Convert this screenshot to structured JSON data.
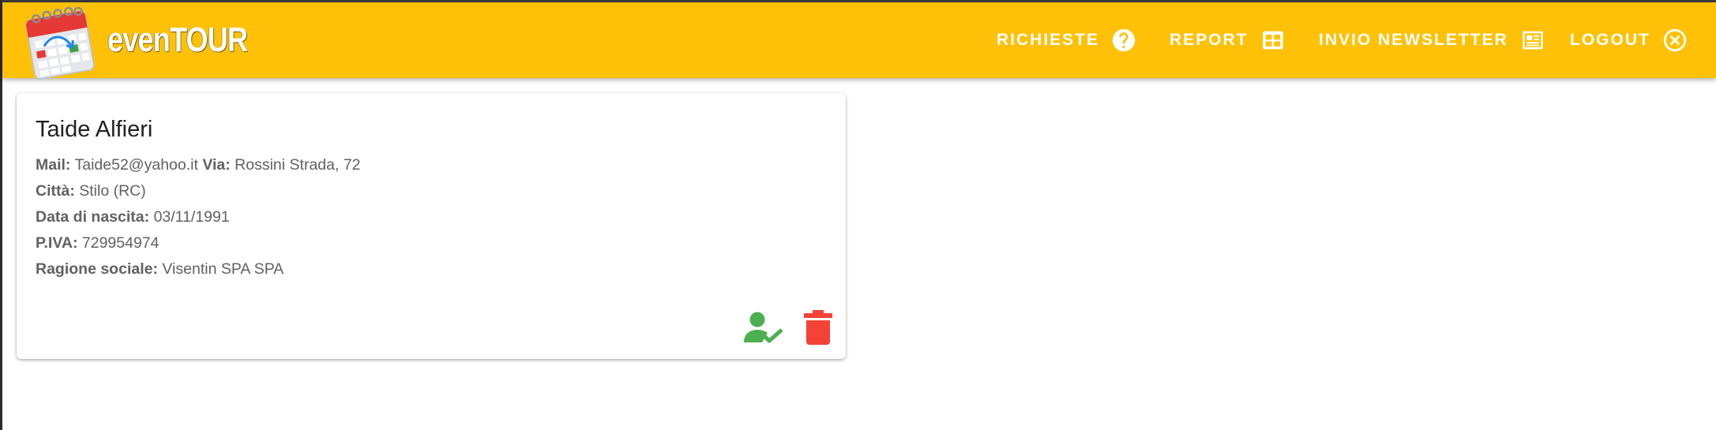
{
  "app": {
    "title": "evenTOUR",
    "accent_color": "#FFC107",
    "logo_icon": "calendar-logo-icon"
  },
  "nav": {
    "items": [
      {
        "label": "RICHIESTE",
        "icon": "help-circle-icon"
      },
      {
        "label": "REPORT",
        "icon": "table-grid-icon"
      },
      {
        "label": "INVIO NEWSLETTER",
        "icon": "newspaper-icon"
      },
      {
        "label": "LOGOUT",
        "icon": "close-circle-icon"
      }
    ]
  },
  "user_card": {
    "name": "Taide Alfieri",
    "mail_label": "Mail:",
    "mail": "Taide52@yahoo.it",
    "via_label": "Via:",
    "via": "Rossini Strada, 72",
    "citta_label": "Città:",
    "citta": "Stilo (RC)",
    "nascita_label": "Data di nascita:",
    "nascita": "03/11/1991",
    "piva_label": "P.IVA:",
    "piva": "729954974",
    "ragione_label": "Ragione sociale:",
    "ragione": "Visentin SPA SPA",
    "actions": {
      "approve_icon": "account-check-icon",
      "approve_color": "#4CAF50",
      "delete_icon": "trash-icon",
      "delete_color": "#F44336"
    }
  }
}
